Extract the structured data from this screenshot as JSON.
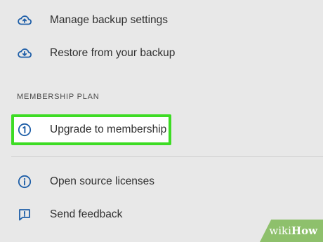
{
  "items": {
    "manage_backup": {
      "label": "Manage backup settings",
      "icon": "cloud-upload-icon"
    },
    "restore_backup": {
      "label": "Restore from your backup",
      "icon": "cloud-download-icon"
    },
    "section_header": "MEMBERSHIP PLAN",
    "upgrade": {
      "label": "Upgrade to membership",
      "icon": "number-one-circle-icon",
      "highlight_color": "#3ddc24"
    },
    "open_source": {
      "label": "Open source licenses",
      "icon": "info-icon"
    },
    "feedback": {
      "label": "Send feedback",
      "icon": "feedback-icon"
    }
  },
  "watermark": {
    "part1": "wiki",
    "part2": "How",
    "color": "#8ec06c"
  },
  "colors": {
    "background": "#e8e8e8",
    "icon": "#1f5fa8",
    "text": "#303030"
  }
}
